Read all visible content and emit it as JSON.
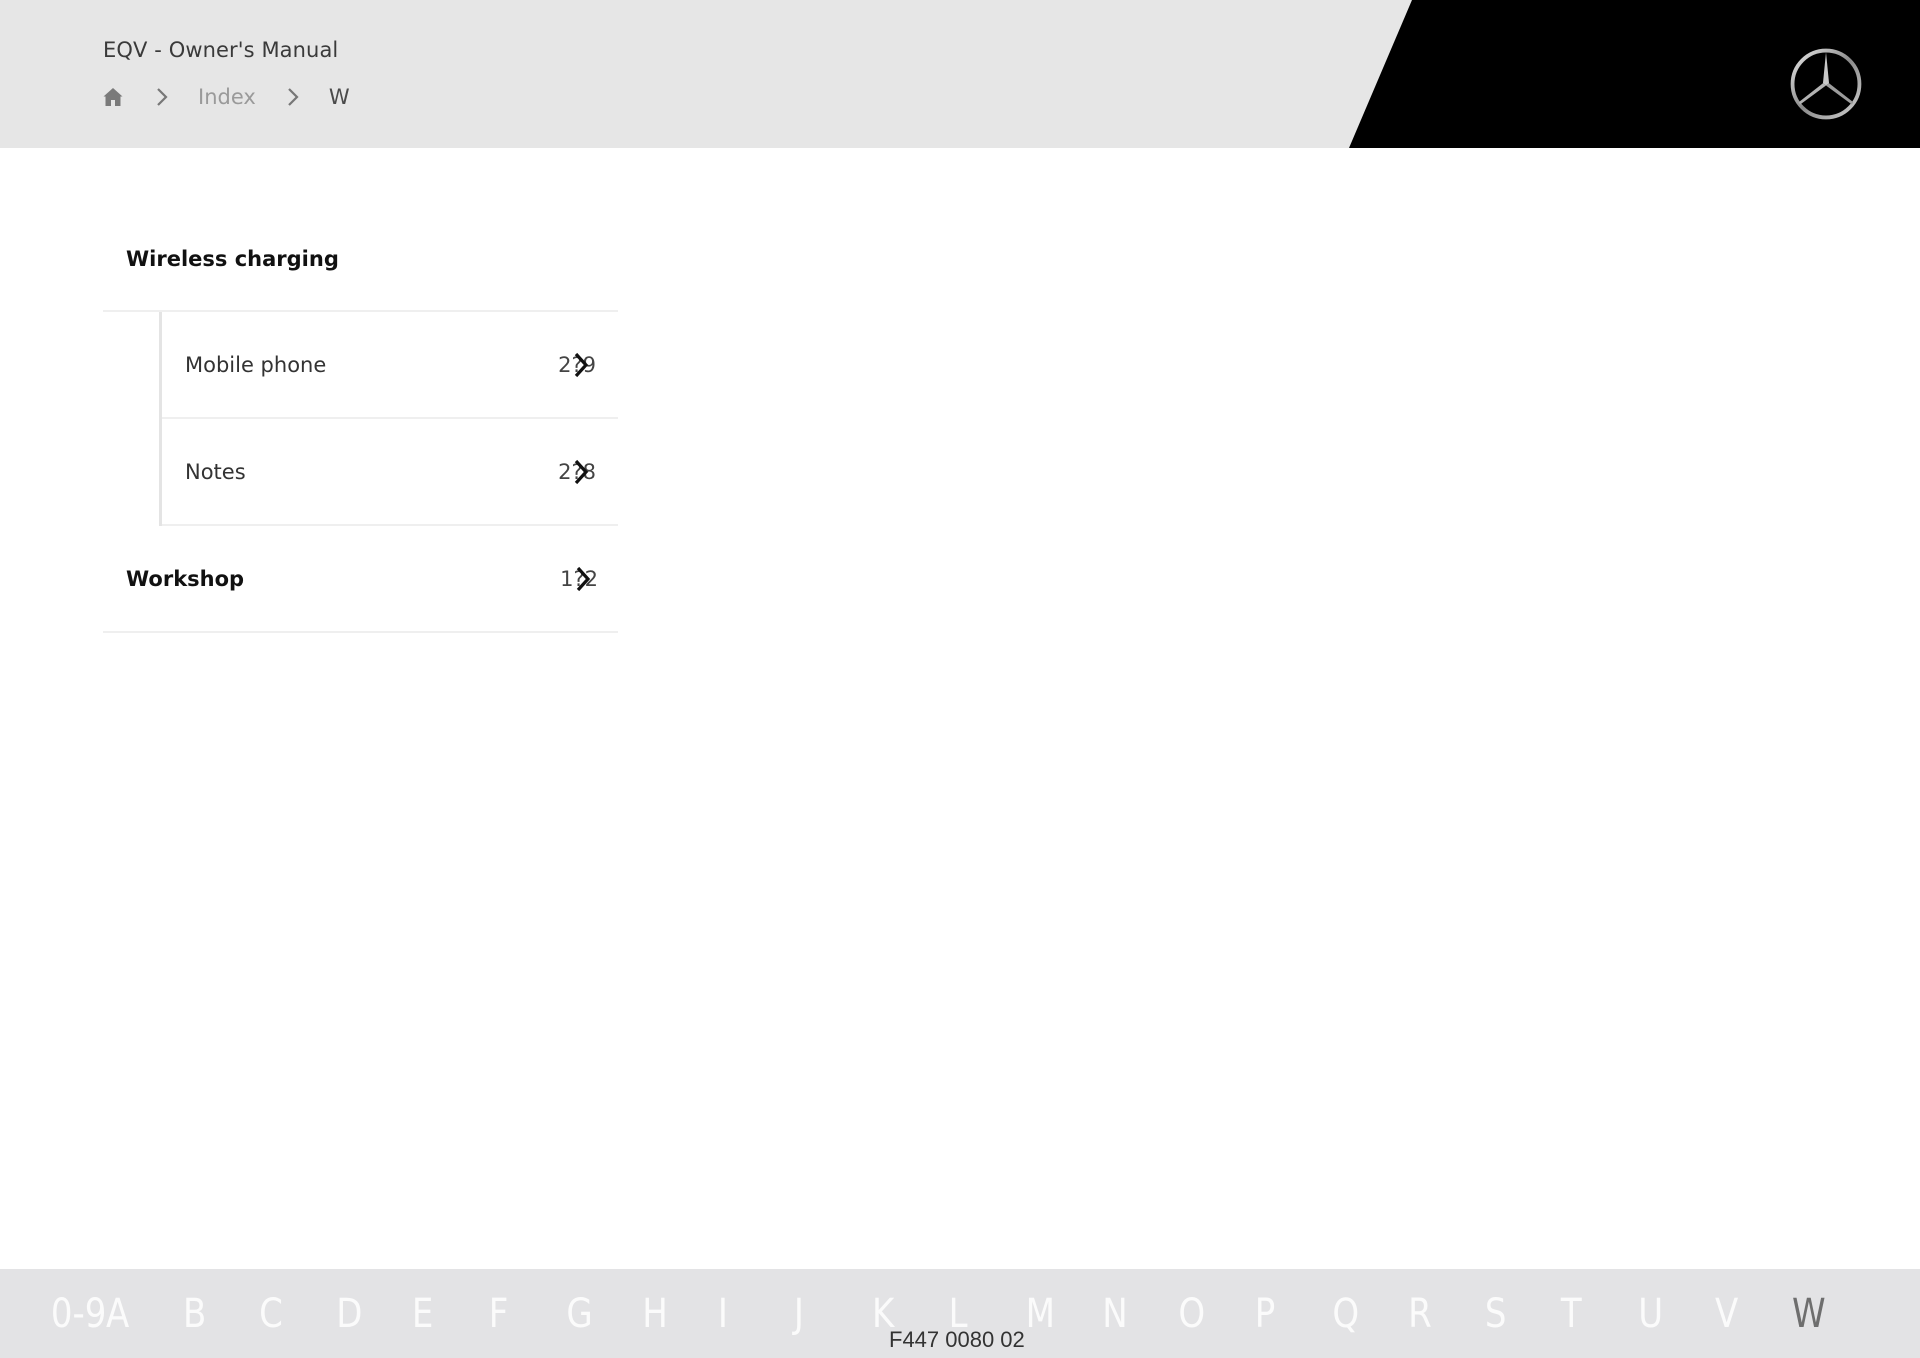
{
  "header": {
    "app_title": "EQV - Owner's Manual",
    "breadcrumb": {
      "home_icon": "home-icon",
      "separator_icon": "chevron-right-icon",
      "items": [
        "Index",
        "W"
      ]
    },
    "logo": "mercedes-star-logo"
  },
  "index": {
    "groups": [
      {
        "title": "Wireless charging",
        "items": [
          {
            "label": "Mobile phone",
            "page": "2?9"
          },
          {
            "label": "Notes",
            "page": "2?8"
          }
        ]
      }
    ],
    "top_items": [
      {
        "label": "Workshop",
        "page": "1?2"
      }
    ],
    "row_icon": "chevron-right-icon"
  },
  "footer": {
    "alphabet": [
      "0-9",
      "A",
      "B",
      "C",
      "D",
      "E",
      "F",
      "G",
      "H",
      "I",
      "J",
      "K",
      "L",
      "M",
      "N",
      "O",
      "P",
      "Q",
      "R",
      "S",
      "T",
      "U",
      "V",
      "W"
    ],
    "active_letter": "W",
    "figure_code": "F447 0080 02"
  },
  "colors": {
    "header_bg": "#e6e6e6",
    "header_black": "#000000",
    "footer_bg": "#e3e3e5",
    "active_letter": "#6e6e6e",
    "inactive_letter": "#fbfbfb"
  }
}
